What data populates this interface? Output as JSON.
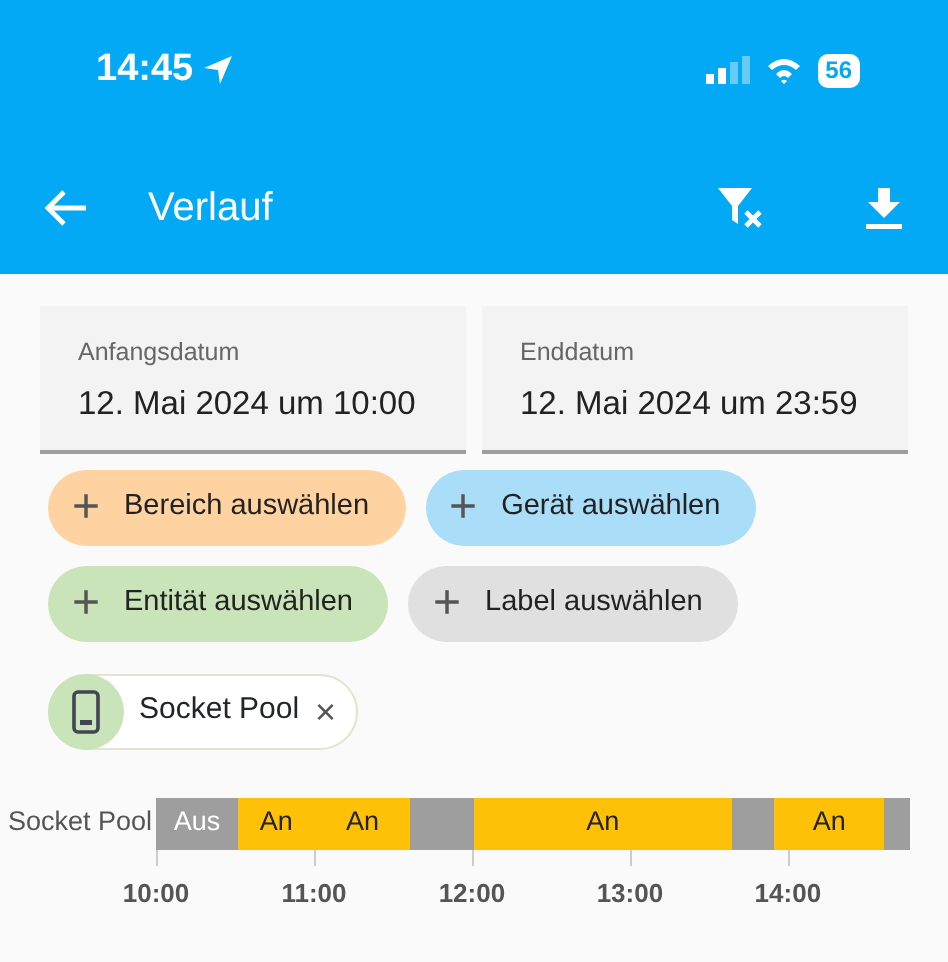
{
  "status_bar": {
    "time": "14:45",
    "battery": "56"
  },
  "app_bar": {
    "title": "Verlauf"
  },
  "date_fields": [
    {
      "label": "Anfangsdatum",
      "value": "12. Mai 2024 um 10:00"
    },
    {
      "label": "Enddatum",
      "value": "12. Mai 2024 um 23:59"
    }
  ],
  "add_chips": [
    {
      "icon": "+",
      "label": "Bereich auswählen",
      "color": "#ffd3a1"
    },
    {
      "icon": "+",
      "label": "Gerät auswählen",
      "color": "#a9ddf8"
    },
    {
      "icon": "+",
      "label": "Entität auswählen",
      "color": "#c8e4b8"
    },
    {
      "icon": "+",
      "label": "Label auswählen",
      "color": "#e0e0e0"
    }
  ],
  "selected_chips": [
    {
      "label": "Socket Pool",
      "remove": "×"
    }
  ],
  "timeline": {
    "rows": [
      {
        "name": "Socket Pool",
        "segments": [
          {
            "on": false,
            "label": "Aus"
          },
          {
            "on": true,
            "label": "An"
          },
          {
            "on": true,
            "label": "An"
          },
          {
            "on": false
          },
          {
            "on": true,
            "label": "An"
          },
          {
            "on": false
          },
          {
            "on": true,
            "label": "An"
          },
          {
            "on": false
          }
        ]
      }
    ],
    "ticks": [
      "10:00",
      "11:00",
      "12:00",
      "13:00",
      "14:00"
    ]
  }
}
